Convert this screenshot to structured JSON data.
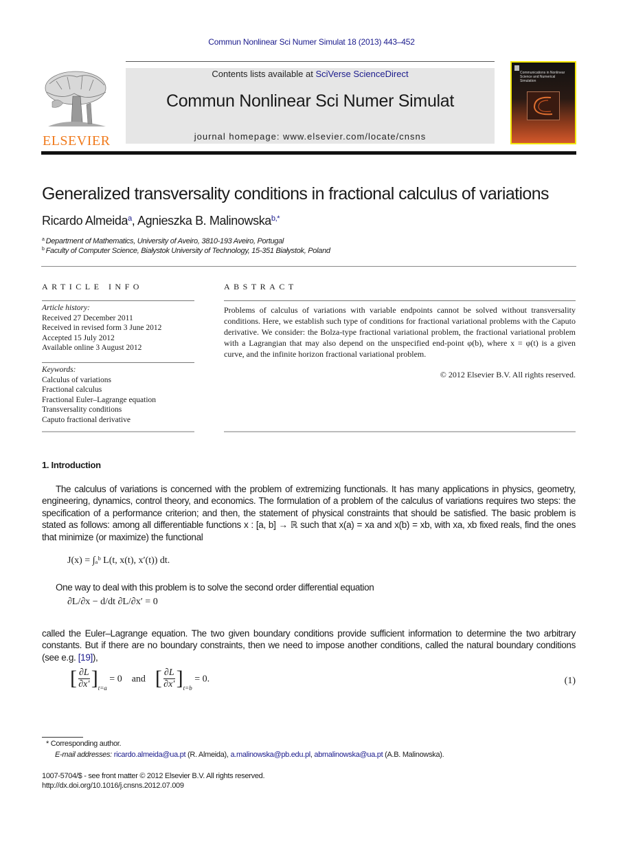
{
  "header": {
    "citation": "Commun Nonlinear Sci Numer Simulat 18 (2013) 443–452",
    "contents_prefix": "Contents lists available at ",
    "contents_link": "SciVerse ScienceDirect",
    "journal_title": "Commun Nonlinear Sci Numer Simulat",
    "homepage": "journal homepage: www.elsevier.com/locate/cnsns",
    "publisher_logo_text": "ELSEVIER",
    "cover_text": "Communications in Nonlinear Science and Numerical Simulation",
    "colors": {
      "elsevier_orange": "#f07a1c",
      "link_blue": "#1a1a8c",
      "cover_border": "#f2e600"
    }
  },
  "article": {
    "title": "Generalized transversality conditions in fractional calculus of variations",
    "authors": [
      {
        "name": "Ricardo Almeida",
        "marks": "a"
      },
      {
        "name": "Agnieszka B. Malinowska",
        "marks": "b,*"
      }
    ],
    "affiliations": [
      {
        "mark": "a",
        "text": "Department of Mathematics, University of Aveiro, 3810-193 Aveiro, Portugal"
      },
      {
        "mark": "b",
        "text": "Faculty of Computer Science, Białystok University of Technology, 15-351 Białystok, Poland"
      }
    ]
  },
  "article_info": {
    "heading": "ARTICLE INFO",
    "history_label": "Article history:",
    "history": [
      "Received 27 December 2011",
      "Received in revised form 3 June 2012",
      "Accepted 15 July 2012",
      "Available online 3 August 2012"
    ],
    "keywords_label": "Keywords:",
    "keywords": [
      "Calculus of variations",
      "Fractional calculus",
      "Fractional Euler–Lagrange equation",
      "Transversality conditions",
      "Caputo fractional derivative"
    ]
  },
  "abstract": {
    "heading": "ABSTRACT",
    "text": "Problems of calculus of variations with variable endpoints cannot be solved without transversality conditions. Here, we establish such type of conditions for fractional variational problems with the Caputo derivative. We consider: the Bolza-type fractional variational problem, the fractional variational problem with a Lagrangian that may also depend on the unspecified end-point φ(b), where x = φ(t) is a given curve, and the infinite horizon fractional variational problem.",
    "copyright": "© 2012 Elsevier B.V. All rights reserved."
  },
  "introduction": {
    "heading": "1. Introduction",
    "para1": "The calculus of variations is concerned with the problem of extremizing functionals. It has many applications in physics, geometry, engineering, dynamics, control theory, and economics. The formulation of a problem of the calculus of variations requires two steps: the specification of a performance criterion; and then, the statement of physical constraints that should be satisfied. The basic problem is stated as follows: among all differentiable functions x : [a, b] → ℝ such that x(a) = xa and x(b) = xb, with xa, xb fixed reals, find the ones that minimize (or maximize) the functional",
    "eq_functional": "J(x) = ∫ₐᵇ L(t, x(t), x′(t)) dt.",
    "para2": "One way to deal with this problem is to solve the second order differential equation",
    "eq_euler_lagrange": "∂L/∂x − d/dt ∂L/∂x′ = 0",
    "para3": "called the Euler–Lagrange equation. The two given boundary conditions provide sufficient information to determine the two arbitrary constants. But if there are no boundary constraints, then we need to impose another conditions, called the natural boundary conditions (see e.g. ",
    "para3_ref": "[19]",
    "para3_end": "),",
    "eq1_and": "and",
    "eq1_sub_a": "t=a",
    "eq1_sub_b": "t=b",
    "eq1_number": "(1)"
  },
  "footnotes": {
    "corresponding": "* Corresponding author.",
    "email_label": "E-mail addresses:",
    "emails": [
      {
        "address": "ricardo.almeida@ua.pt",
        "owner": " (R. Almeida), "
      },
      {
        "address": "a.malinowska@pb.edu.pl",
        "owner": ", "
      },
      {
        "address": "abmalinowska@ua.pt",
        "owner": " (A.B. Malinowska)."
      }
    ],
    "issn": "1007-5704/$ - see front matter © 2012 Elsevier B.V. All rights reserved.",
    "doi": "http://dx.doi.org/10.1016/j.cnsns.2012.07.009"
  }
}
